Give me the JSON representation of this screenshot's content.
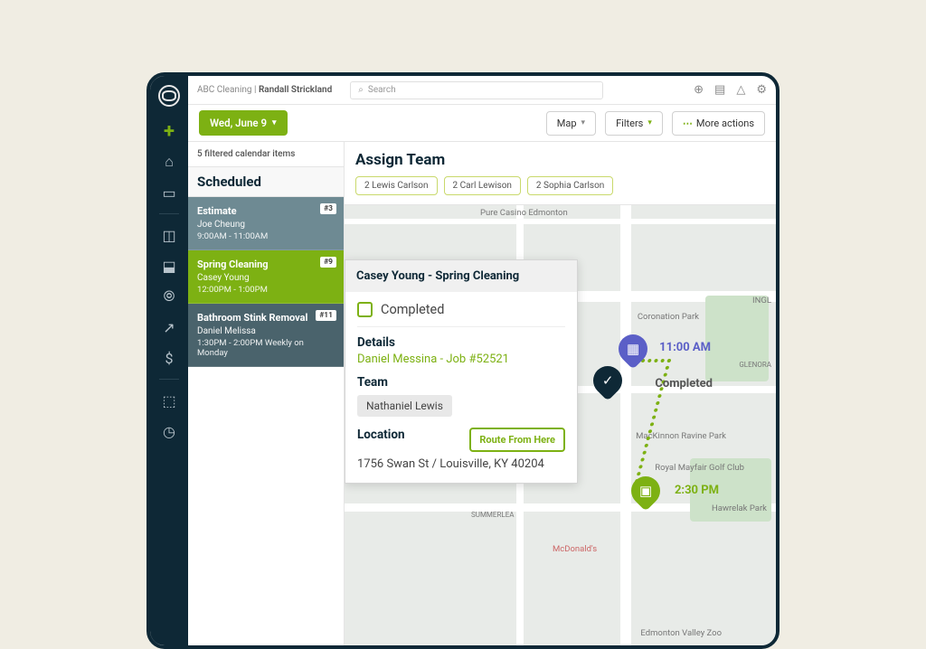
{
  "breadcrumb": {
    "company": "ABC Cleaning",
    "user": "Randall Strickland"
  },
  "search": {
    "placeholder": "Search"
  },
  "toolbar": {
    "date": "Wed, June 9",
    "map": "Map",
    "filters": "Filters",
    "more": "More actions"
  },
  "sidebar": {
    "filter_info": "5 filtered calendar items",
    "header": "Scheduled",
    "items": [
      {
        "title": "Estimate",
        "badge": "#3",
        "name": "Joe Cheung",
        "time": "9:00AM - 11:00AM"
      },
      {
        "title": "Spring Cleaning",
        "badge": "#9",
        "name": "Casey Young",
        "time": "12:00PM - 1:00PM"
      },
      {
        "title": "Bathroom Stink Removal",
        "badge": "#11",
        "name": "Daniel Melissa",
        "time": "1:30PM - 2:00PM Weekly on Monday"
      }
    ]
  },
  "assign": {
    "title": "Assign Team",
    "chips": [
      "2 Lewis Carlson",
      "2 Carl Lewison",
      "2 Sophia Carlson"
    ]
  },
  "popup": {
    "title": "Casey Young - Spring Cleaning",
    "completed": "Completed",
    "details_label": "Details",
    "details_link": "Daniel Messina - Job #52521",
    "team_label": "Team",
    "team_member": "Nathaniel Lewis",
    "location_label": "Location",
    "route_btn": "Route From Here",
    "address": "1756 Swan St / Louisville, KY 40204"
  },
  "map": {
    "pin1_time": "11:00 AM",
    "pin1_status": "Completed",
    "pin2_time": "2:30 PM",
    "labels": {
      "coronation": "Coronation Park",
      "mackinnon": "MacKinnon Ravine Park",
      "mayfair": "Royal Mayfair Golf Club",
      "hawrelak": "Hawrelak Park",
      "summerlea": "SUMMERLEA",
      "glenora": "GLENORA",
      "mcdonalds": "McDonald's",
      "zoo": "Edmonton Valley Zoo",
      "casino": "Pure Casino Edmonton",
      "ingl": "INGL"
    }
  }
}
